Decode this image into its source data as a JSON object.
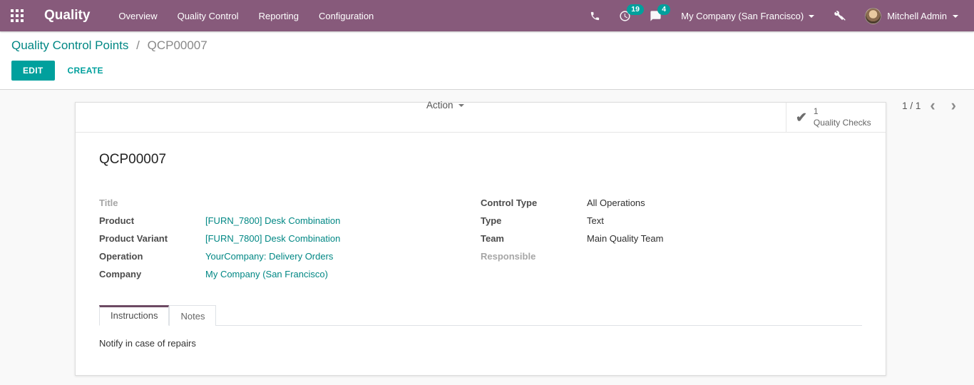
{
  "navbar": {
    "brand": "Quality",
    "menu": [
      "Overview",
      "Quality Control",
      "Reporting",
      "Configuration"
    ],
    "activity_count": "19",
    "message_count": "4",
    "company": "My Company (San Francisco)",
    "user": "Mitchell Admin"
  },
  "breadcrumb": {
    "parent": "Quality Control Points",
    "separator": "/",
    "current": "QCP00007"
  },
  "control_panel": {
    "edit": "EDIT",
    "create": "CREATE",
    "action": "Action",
    "pager": "1 / 1"
  },
  "icons": {
    "check": "✔",
    "chevron_left": "‹",
    "chevron_right": "›"
  },
  "stat_button": {
    "value": "1",
    "label": "Quality Checks"
  },
  "sheet": {
    "title": "QCP00007",
    "fields_left": [
      {
        "label": "Title",
        "value": ""
      },
      {
        "label": "Product",
        "value": "[FURN_7800] Desk Combination"
      },
      {
        "label": "Product Variant",
        "value": "[FURN_7800] Desk Combination"
      },
      {
        "label": "Operation",
        "value": "YourCompany: Delivery Orders"
      },
      {
        "label": "Company",
        "value": "My Company (San Francisco)"
      }
    ],
    "fields_right": [
      {
        "label": "Control Type",
        "value": "All Operations"
      },
      {
        "label": "Type",
        "value": "Text"
      },
      {
        "label": "Team",
        "value": "Main Quality Team"
      },
      {
        "label": "Responsible",
        "value": ""
      }
    ],
    "tabs": [
      {
        "label": "Instructions"
      },
      {
        "label": "Notes"
      }
    ],
    "tab_content": "Notify in case of repairs"
  },
  "colors": {
    "navbar": "#875A7B",
    "accent": "#00A09D",
    "link": "#008784",
    "badge": "#00A09D"
  }
}
